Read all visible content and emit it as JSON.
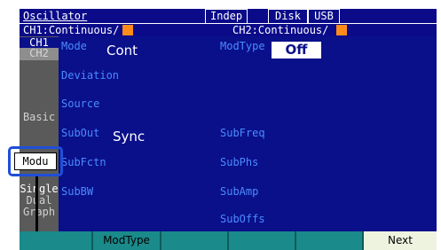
{
  "titlebar": {
    "title": "Oscillator",
    "mode": "Indep",
    "disk": "Disk",
    "usb": "USB"
  },
  "status": {
    "ch1": "CH1:Continuous/",
    "ch2": "CH2:Continuous/",
    "indicator_color": "#ff8c1a"
  },
  "tabs": {
    "ch1": "CH1",
    "ch2": "CH2",
    "basic": "Basic",
    "modu": "Modu",
    "single": "Single",
    "dual": "Dual Graph"
  },
  "params": {
    "mode_label": "Mode",
    "mode_value": "Cont",
    "deviation_label": "Deviation",
    "source_label": "Source",
    "subout_label": "SubOut",
    "subout_value": "Sync",
    "subfctn_label": "SubFctn",
    "subbw_label": "SubBW",
    "modtype_label": "ModType",
    "modtype_value": "Off",
    "subfreq_label": "SubFreq",
    "subphs_label": "SubPhs",
    "subamp_label": "SubAmp",
    "suboffs_label": "SubOffs"
  },
  "softkeys": [
    "",
    "ModType",
    "",
    "",
    "",
    "Next"
  ],
  "colors": {
    "panel": "#0a0f8a",
    "label": "#4a8cff",
    "softbar": "#1a8a8a",
    "highlight": "#1f4fd8"
  }
}
